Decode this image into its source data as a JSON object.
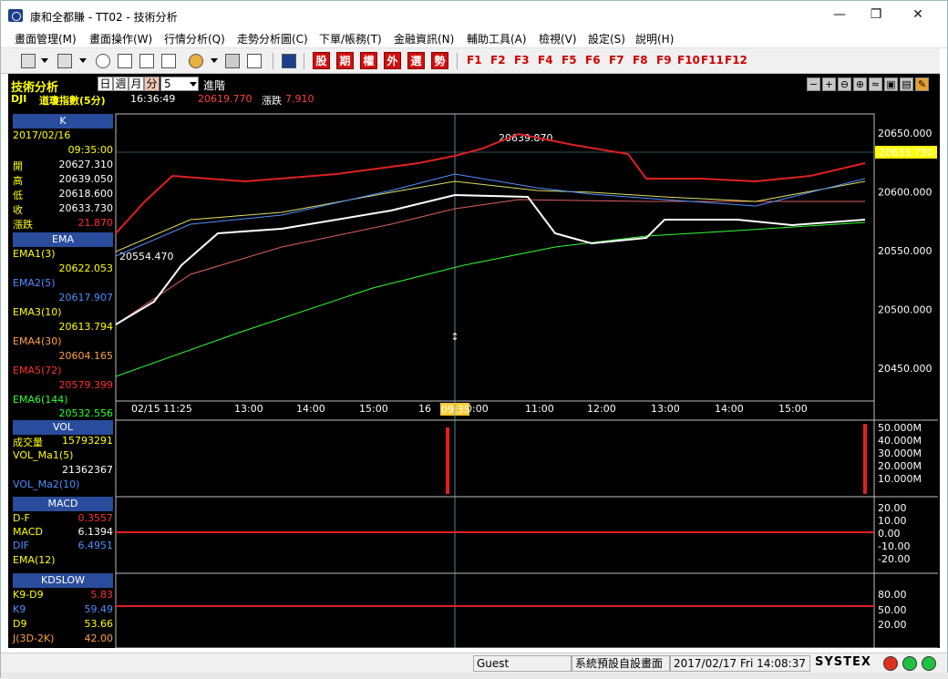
{
  "window": {
    "title": "康和全都賺 - TT02 - 技術分析",
    "controls": {
      "minimize": "—",
      "maximize": "❐",
      "close": "✕"
    }
  },
  "menu": [
    "畫面管理(M)",
    "畫面操作(W)",
    "行情分析(Q)",
    "走勢分析圖(C)",
    "下單/帳務(T)",
    "金融資訊(N)",
    "輔助工具(A)",
    "檢視(V)",
    "設定(S)",
    "說明(H)"
  ],
  "toolbar": {
    "red_buttons": [
      "股",
      "期",
      "權",
      "外",
      "選",
      "勢"
    ],
    "fkeys": [
      "F1",
      "F2",
      "F3",
      "F4",
      "F5",
      "F6",
      "F7",
      "F8",
      "F9",
      "F10",
      "F11",
      "F12"
    ]
  },
  "header": {
    "title": "技術分析",
    "periods": [
      "日",
      "週",
      "月",
      "分"
    ],
    "selected_period": "分",
    "interval_value": "5",
    "adv_label": "進階",
    "symbol": "DJI",
    "name": "道瓊指數(5分)",
    "time": "16:36:49",
    "price": "20619.770",
    "change_label": "漲跌",
    "change": "7.910"
  },
  "info_panel": {
    "k_header": "K",
    "date": "2017/02/16",
    "time": "09:35:00",
    "ohlc": [
      {
        "label": "開",
        "value": "20627.310"
      },
      {
        "label": "高",
        "value": "20639.050"
      },
      {
        "label": "低",
        "value": "20618.600"
      },
      {
        "label": "收",
        "value": "20633.730"
      },
      {
        "label": "漲跌",
        "value": "21.870"
      }
    ],
    "ema_header": "EMA",
    "ema": [
      {
        "label": "EMA1(3)",
        "value": "20622.053",
        "color": "#ffff00"
      },
      {
        "label": "EMA2(5)",
        "value": "20617.907",
        "color": "#4f8fff"
      },
      {
        "label": "EMA3(10)",
        "value": "20613.794",
        "color": "#ffff00"
      },
      {
        "label": "EMA4(30)",
        "value": "20604.165",
        "color": "#ffa040"
      },
      {
        "label": "EMA5(72)",
        "value": "20579.399",
        "color": "#ff3030"
      },
      {
        "label": "EMA6(144)",
        "value": "20532.556",
        "color": "#30ff30"
      }
    ],
    "vol_header": "VOL",
    "vol": [
      {
        "label": "成交量",
        "value": "15793291"
      },
      {
        "label": "VOL_Ma1(5)",
        "value": "21362367"
      },
      {
        "label": "VOL_Ma2(10)",
        "value": ""
      }
    ],
    "macd_header": "MACD",
    "macd": [
      {
        "label": "D-F",
        "value": "0.3557"
      },
      {
        "label": "MACD",
        "value": "6.1394"
      },
      {
        "label": "DIF",
        "value": "6.4951"
      },
      {
        "label": "EMA(12)",
        "value": ""
      }
    ],
    "kd_header": "KDSLOW",
    "kd": [
      {
        "label": "K9-D9",
        "value": "5.83"
      },
      {
        "label": "K9",
        "value": "59.49"
      },
      {
        "label": "D9",
        "value": "53.66"
      },
      {
        "label": "J(3D-2K)",
        "value": "42.00"
      }
    ]
  },
  "chart": {
    "price_axis": [
      "20650.000",
      "20600.000",
      "20550.000",
      "20500.000",
      "20450.000"
    ],
    "current_price": "20633.730",
    "time_axis": [
      "02/15 11:25",
      "13:00",
      "14:00",
      "15:00",
      "16",
      "10:00",
      "11:00",
      "12:00",
      "13:00",
      "14:00",
      "15:00"
    ],
    "cursor_time": "09:35",
    "high_annotation": "20639.870",
    "low_annotation": "20554.470",
    "vol_axis": [
      "50.000M",
      "40.000M",
      "30.000M",
      "20.000M",
      "10.000M"
    ],
    "macd_axis": [
      "20.00",
      "10.00",
      "0.00",
      "-10.00",
      "-20.00"
    ],
    "kd_axis": [
      "80.00",
      "50.00",
      "20.00"
    ]
  },
  "status": {
    "user": "Guest",
    "layout": "系統預設自設畫面",
    "datetime": "2017/02/17 Fri 14:08:37",
    "brand": "SYSTEX"
  }
}
